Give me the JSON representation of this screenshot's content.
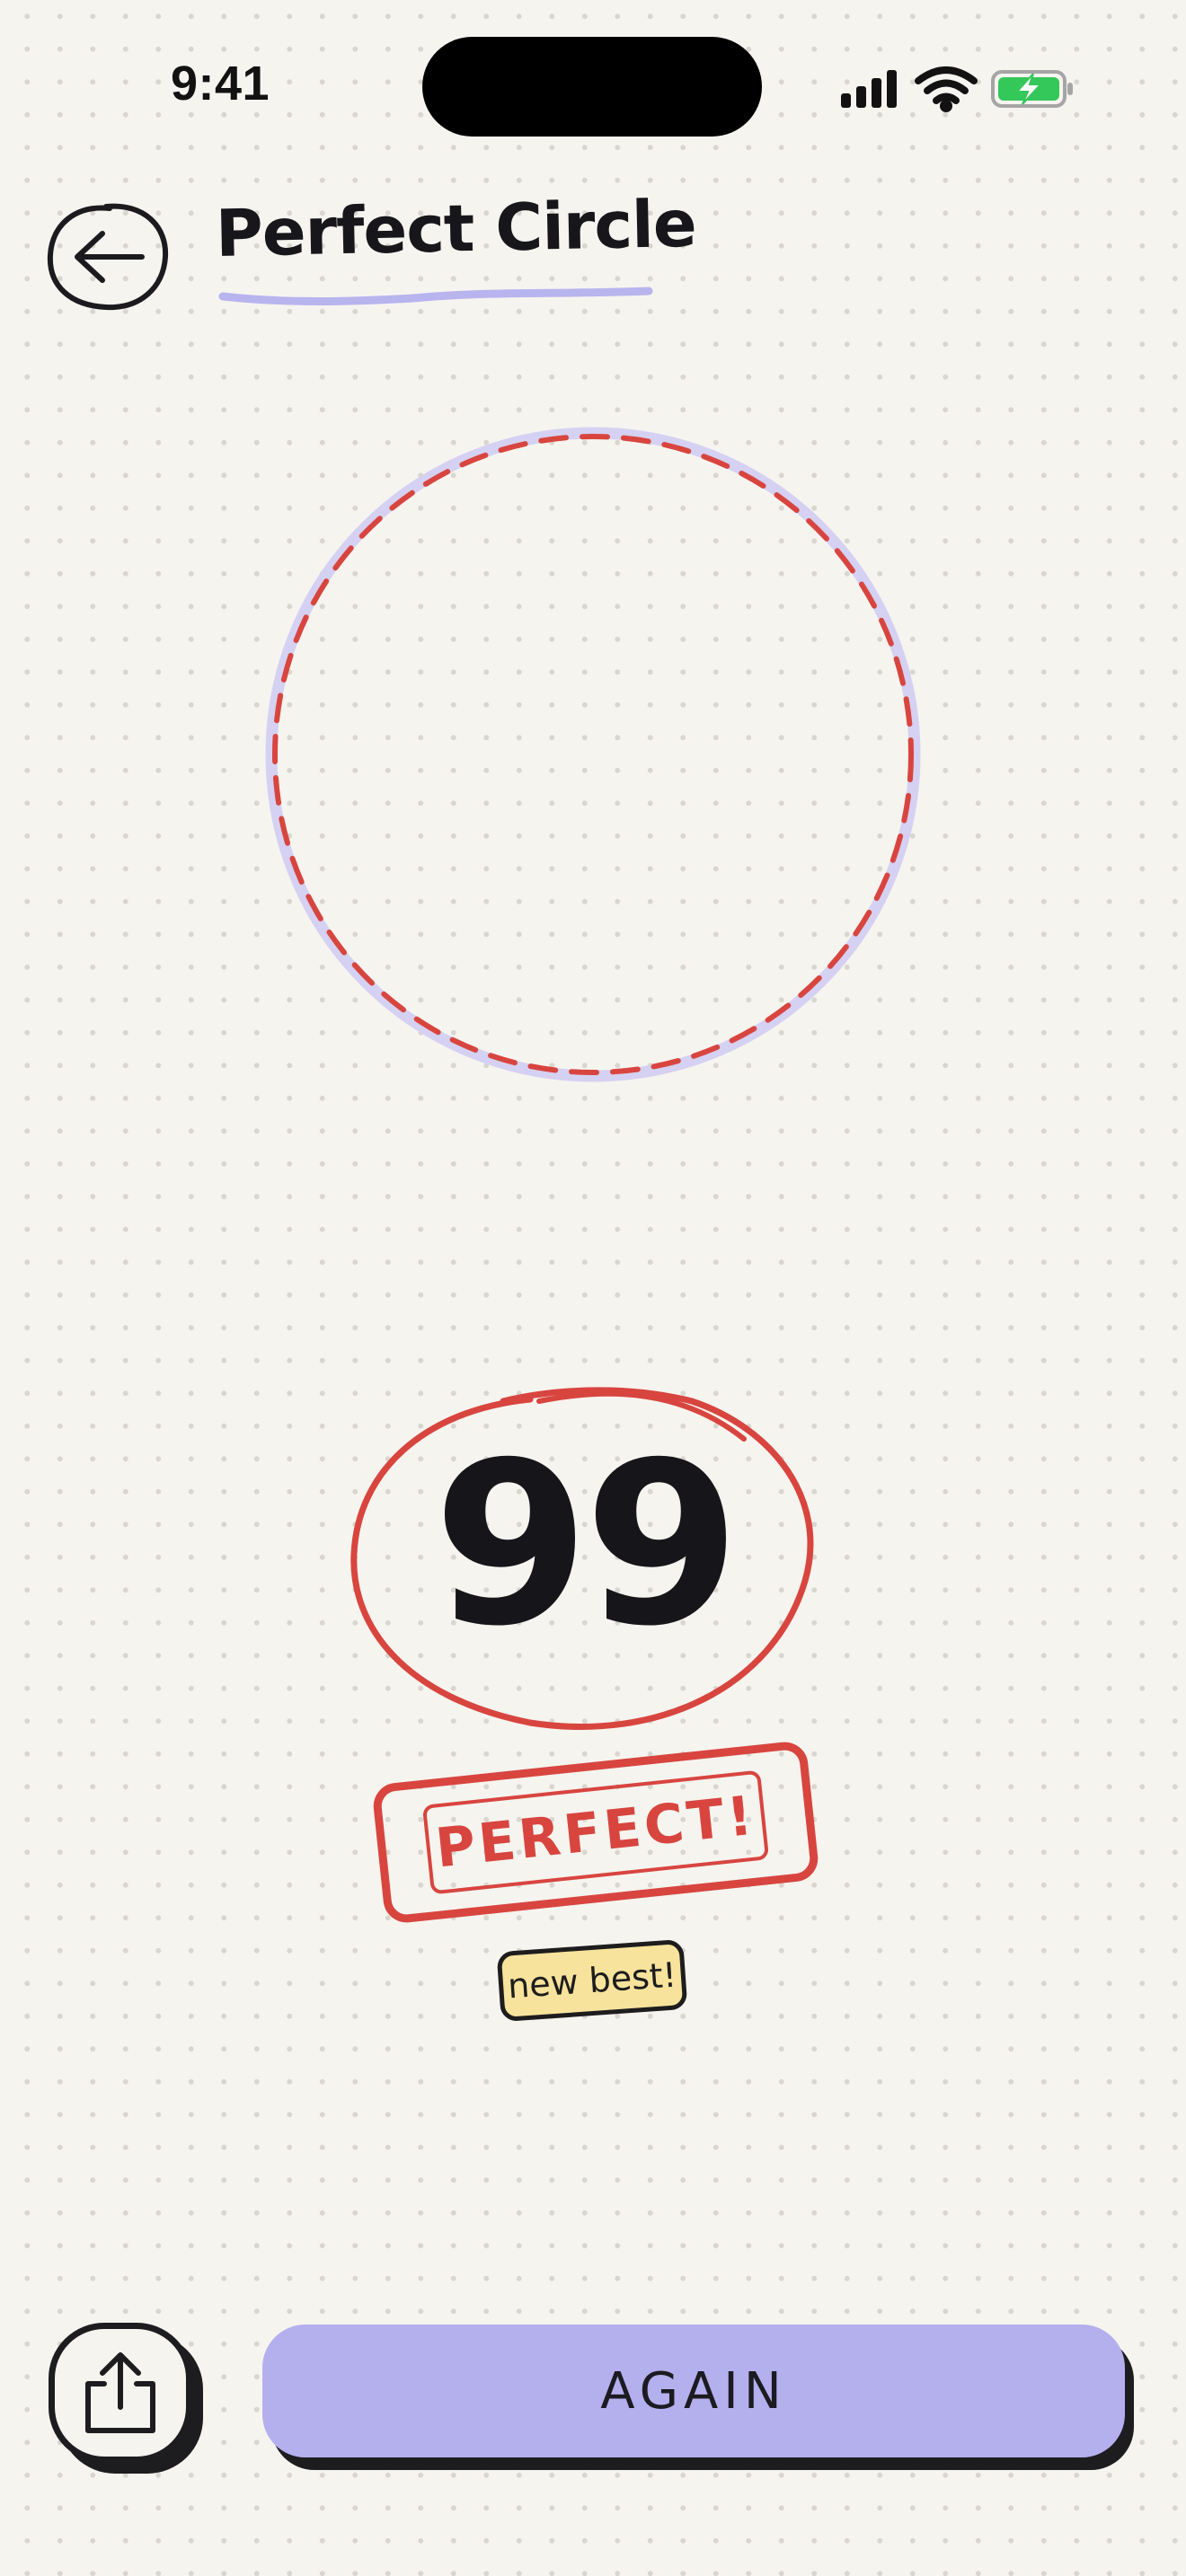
{
  "status_bar": {
    "time": "9:41",
    "icons": [
      "cellular-signal-icon",
      "wifi-icon",
      "battery-charging-icon"
    ],
    "battery_color": "#34c759"
  },
  "header": {
    "back_icon": "arrow-left-icon",
    "title": "Perfect Circle",
    "accent_color": "#b8b4ee"
  },
  "canvas": {
    "guide_color": "#d5d1f2",
    "drawn_stroke_color": "#d8453f"
  },
  "result": {
    "score": "99",
    "rating": "PERFECT!",
    "badge": "new best!",
    "stamp_color": "#d8453f",
    "badge_color": "#f8e39c"
  },
  "actions": {
    "share_icon": "share-icon",
    "again_label": "AGAIN",
    "again_color": "#b4b0ee"
  }
}
